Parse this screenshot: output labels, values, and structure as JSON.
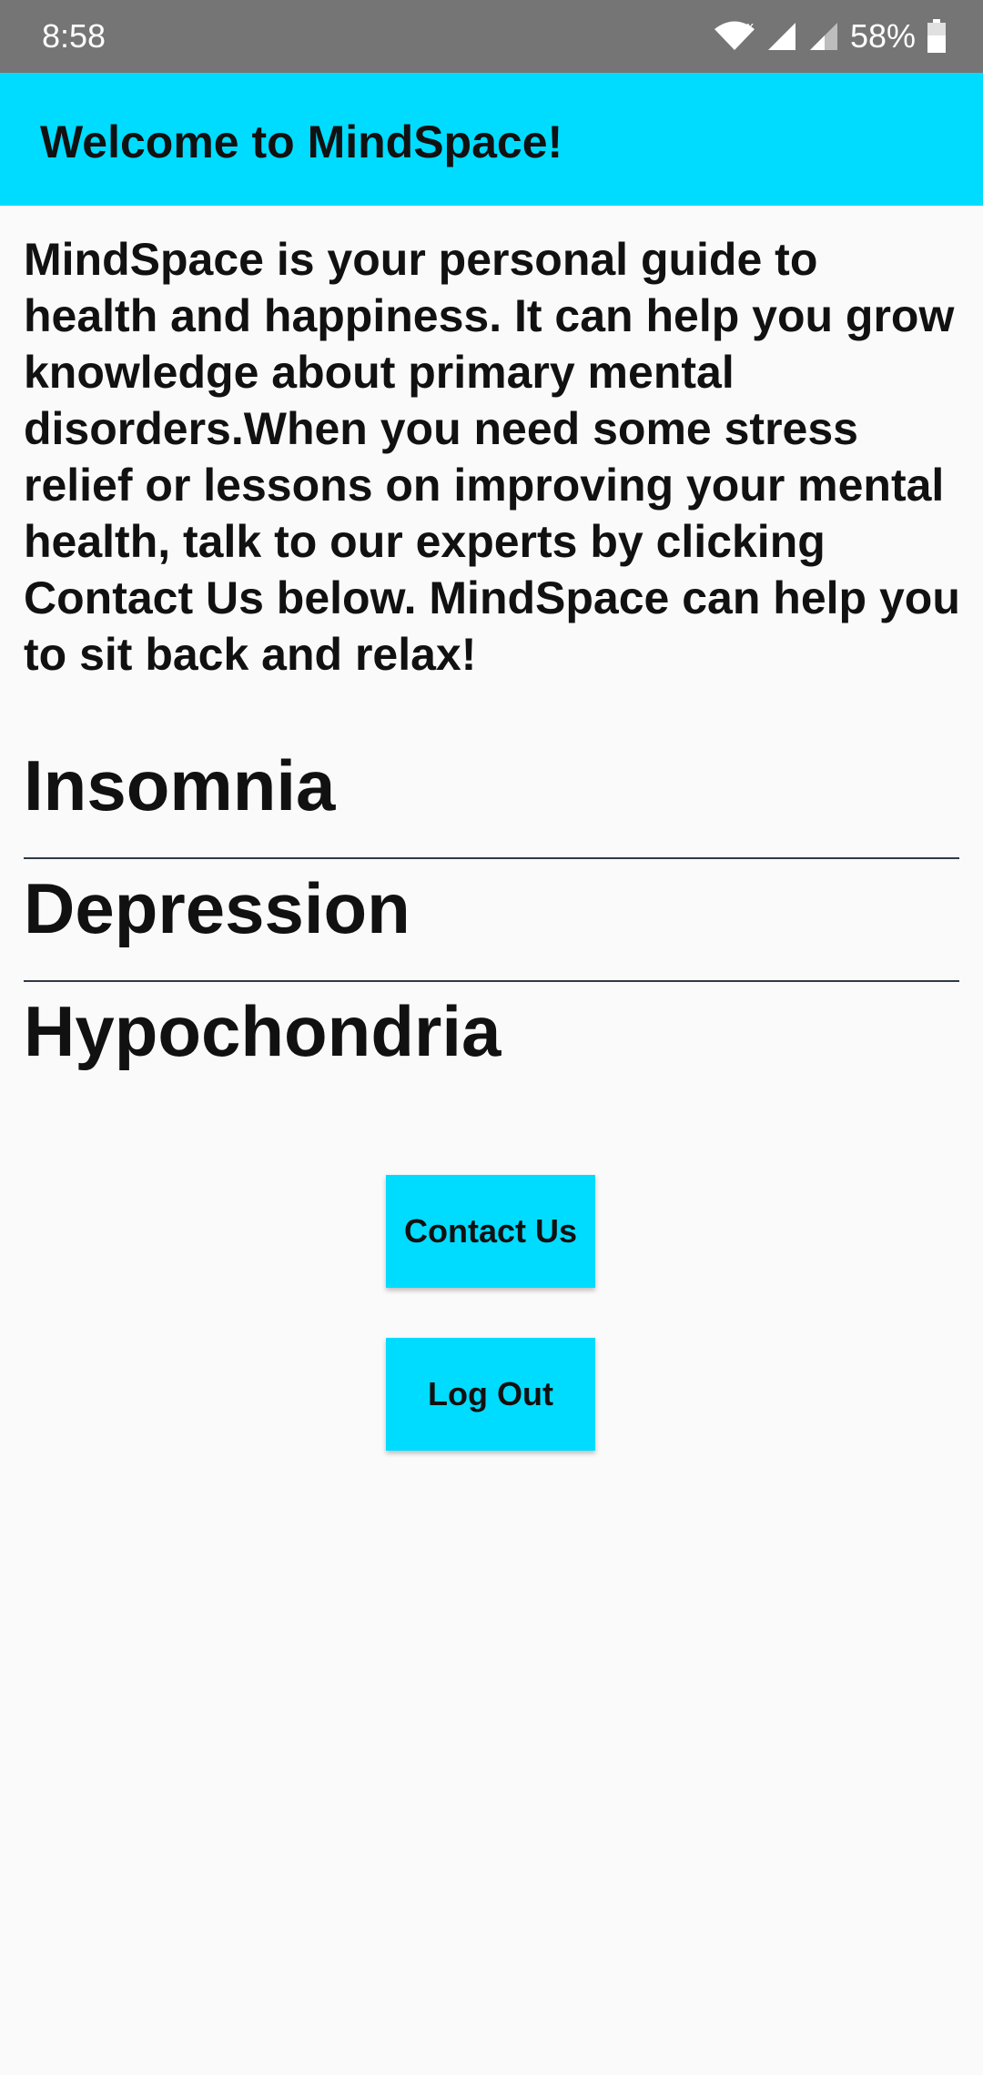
{
  "status_bar": {
    "time": "8:58",
    "battery_percent": "58%",
    "icons": [
      "wifi-icon",
      "signal-icon",
      "signal-icon",
      "battery-icon"
    ],
    "background_color": "#757575"
  },
  "app_bar": {
    "title": "Welcome to MindSpace!",
    "background_color": "#00dcff"
  },
  "intro_text": "MindSpace is your personal guide to health and happiness. It can help you grow knowledge about primary mental disorders.When you need some stress relief or lessons on improving your mental health, talk to our experts by clicking Contact Us below. MindSpace can help you to sit back and relax!",
  "topics": [
    {
      "label": "Insomnia"
    },
    {
      "label": "Depression"
    },
    {
      "label": "Hypochondria"
    }
  ],
  "buttons": {
    "contact_label": "Contact Us",
    "logout_label": "Log Out",
    "color": "#00dcff"
  }
}
